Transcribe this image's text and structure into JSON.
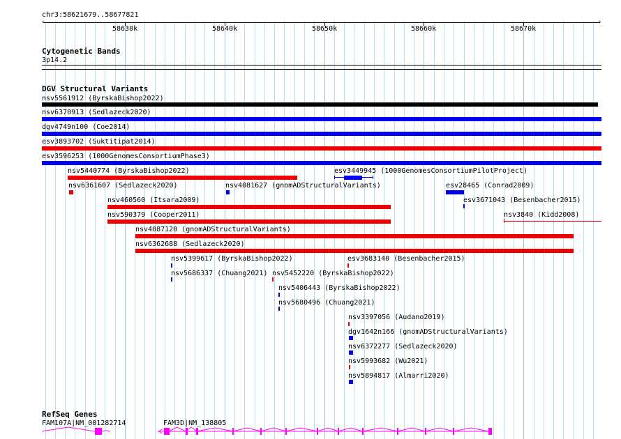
{
  "position": {
    "coordinates": "chr3:58621679..58677821",
    "start": 58621679,
    "end": 58677821,
    "ticks": [
      {
        "pos": 58630000,
        "label": "58630k"
      },
      {
        "pos": 58640000,
        "label": "58640k"
      },
      {
        "pos": 58650000,
        "label": "58650k"
      },
      {
        "pos": 58660000,
        "label": "58660k"
      },
      {
        "pos": 58670000,
        "label": "58670k"
      }
    ]
  },
  "cytobands": {
    "title": "Cytogenetic Bands",
    "band_label": "3p14.2"
  },
  "dgv": {
    "title": "DGV Structural Variants",
    "variants": [
      {
        "id": "nsv5561912",
        "label": "nsv5561912 (ByrskaBishop2022)",
        "color": "#000000"
      },
      {
        "id": "nsv6370913",
        "label": "nsv6370913 (Sedlazeck2020)",
        "color": "#0000ee"
      },
      {
        "id": "dgv4749n100",
        "label": "dgv4749n100 (Coe2014)",
        "color": "#0000ee"
      },
      {
        "id": "esv3893702",
        "label": "esv3893702 (Suktitipat2014)",
        "color": "#ee0000"
      },
      {
        "id": "esv3596253",
        "label": "esv3596253 (1000GenomesConsortiumPhase3)",
        "color": "#0000ee"
      },
      {
        "id": "nsv5440774",
        "label": "nsv5440774 (ByrskaBishop2022)",
        "color": "#ee0000"
      },
      {
        "id": "esv3449945",
        "label": "esv3449945 (1000GenomesConsortiumPilotProject)",
        "color": "#0000ee"
      },
      {
        "id": "nsv6361607",
        "label": "nsv6361607 (Sedlazeck2020)",
        "color": "#ee0000"
      },
      {
        "id": "nsv4081627",
        "label": "nsv4081627 (gnomADStructuralVariants)",
        "color": "#0000ee"
      },
      {
        "id": "esv28465",
        "label": "esv28465 (Conrad2009)",
        "color": "#0000ee"
      },
      {
        "id": "esv3671043",
        "label": "esv3671043 (Besenbacher2015)",
        "color": "#0000ee"
      },
      {
        "id": "nsv460560",
        "label": "nsv460560 (Itsara2009)",
        "color": "#ee0000"
      },
      {
        "id": "nsv3840",
        "label": "nsv3840 (Kidd2008)",
        "color": "#ee0000"
      },
      {
        "id": "nsv590379",
        "label": "nsv590379 (Cooper2011)",
        "color": "#ee0000"
      },
      {
        "id": "nsv4087120",
        "label": "nsv4087120 (gnomADStructuralVariants)",
        "color": "#ee0000"
      },
      {
        "id": "nsv6362688",
        "label": "nsv6362688 (Sedlazeck2020)",
        "color": "#ee0000"
      },
      {
        "id": "nsv5399617",
        "label": "nsv5399617 (ByrskaBishop2022)",
        "color": "#0000ee"
      },
      {
        "id": "esv3683140",
        "label": "esv3683140 (Besenbacher2015)",
        "color": "#ee0000"
      },
      {
        "id": "nsv5686337",
        "label": "nsv5686337 (Chuang2021)",
        "color": "#0000ee"
      },
      {
        "id": "nsv5452220",
        "label": "nsv5452220 (ByrskaBishop2022)",
        "color": "#ee0000"
      },
      {
        "id": "nsv5406443",
        "label": "nsv5406443 (ByrskaBishop2022)",
        "color": "#0000ee"
      },
      {
        "id": "nsv5680496",
        "label": "nsv5680496 (Chuang2021)",
        "color": "#0000ee"
      },
      {
        "id": "nsv3397056",
        "label": "nsv3397056 (Audano2019)",
        "color": "#ee0000"
      },
      {
        "id": "dgv1642n166",
        "label": "dgv1642n166 (gnomADStructuralVariants)",
        "color": "#0000ee"
      },
      {
        "id": "nsv6372277",
        "label": "nsv6372277 (Sedlazeck2020)",
        "color": "#0000ee"
      },
      {
        "id": "nsv5993682",
        "label": "nsv5993682 (Wu2021)",
        "color": "#ee0000"
      },
      {
        "id": "nsv5894817",
        "label": "nsv5894817 (Almarri2020)",
        "color": "#0000ee"
      }
    ]
  },
  "refseq": {
    "title": "RefSeq Genes",
    "genes": [
      {
        "id": "FAM107A",
        "label": "FAM107A|NM_001282714",
        "color": "#ff00ff"
      },
      {
        "id": "FAM3D",
        "label": "FAM3D|NM_138805",
        "color": "#ff00ff"
      }
    ]
  },
  "colors": {
    "grid": "#b8dcf0",
    "gain": "#0000ee",
    "loss": "#ee0000",
    "complex": "#000000",
    "gene": "#ff00ff"
  }
}
